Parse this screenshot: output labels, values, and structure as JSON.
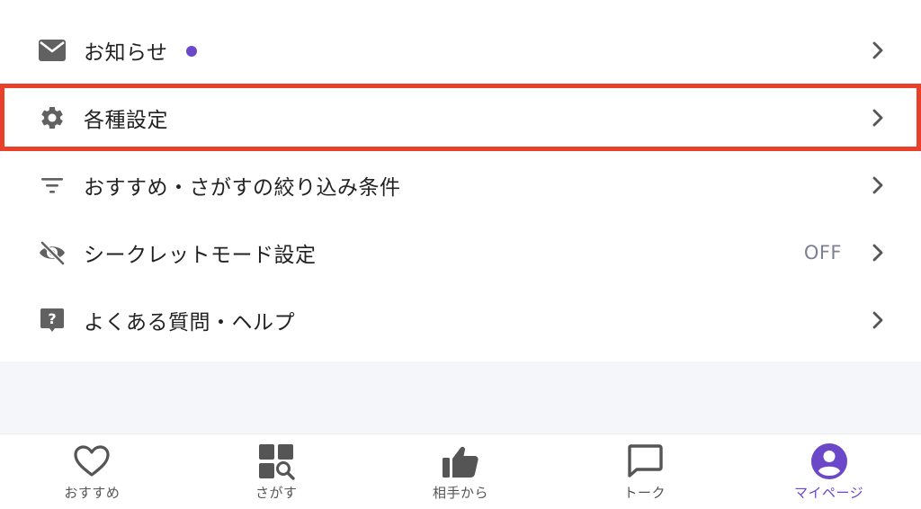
{
  "menu": {
    "items": [
      {
        "label": "お知らせ",
        "icon": "mail-icon",
        "has_dot": true
      },
      {
        "label": "各種設定",
        "icon": "gear-icon",
        "highlighted": true
      },
      {
        "label": "おすすめ・さがすの絞り込み条件",
        "icon": "filter-icon"
      },
      {
        "label": "シークレットモード設定",
        "icon": "eye-off-icon",
        "value": "OFF"
      },
      {
        "label": "よくある質問・ヘルプ",
        "icon": "help-icon"
      }
    ]
  },
  "tabbar": {
    "tabs": [
      {
        "label": "おすすめ",
        "icon": "heart-icon"
      },
      {
        "label": "さがす",
        "icon": "search-grid-icon"
      },
      {
        "label": "相手から",
        "icon": "thumbs-up-icon"
      },
      {
        "label": "トーク",
        "icon": "chat-icon"
      },
      {
        "label": "マイページ",
        "icon": "account-icon",
        "active": true
      }
    ]
  },
  "colors": {
    "accent": "#6b48c8",
    "highlight_border": "#e8402a",
    "icon_gray": "#616161",
    "value_gray": "#7d8090",
    "band_bg": "#f5f6fa"
  }
}
